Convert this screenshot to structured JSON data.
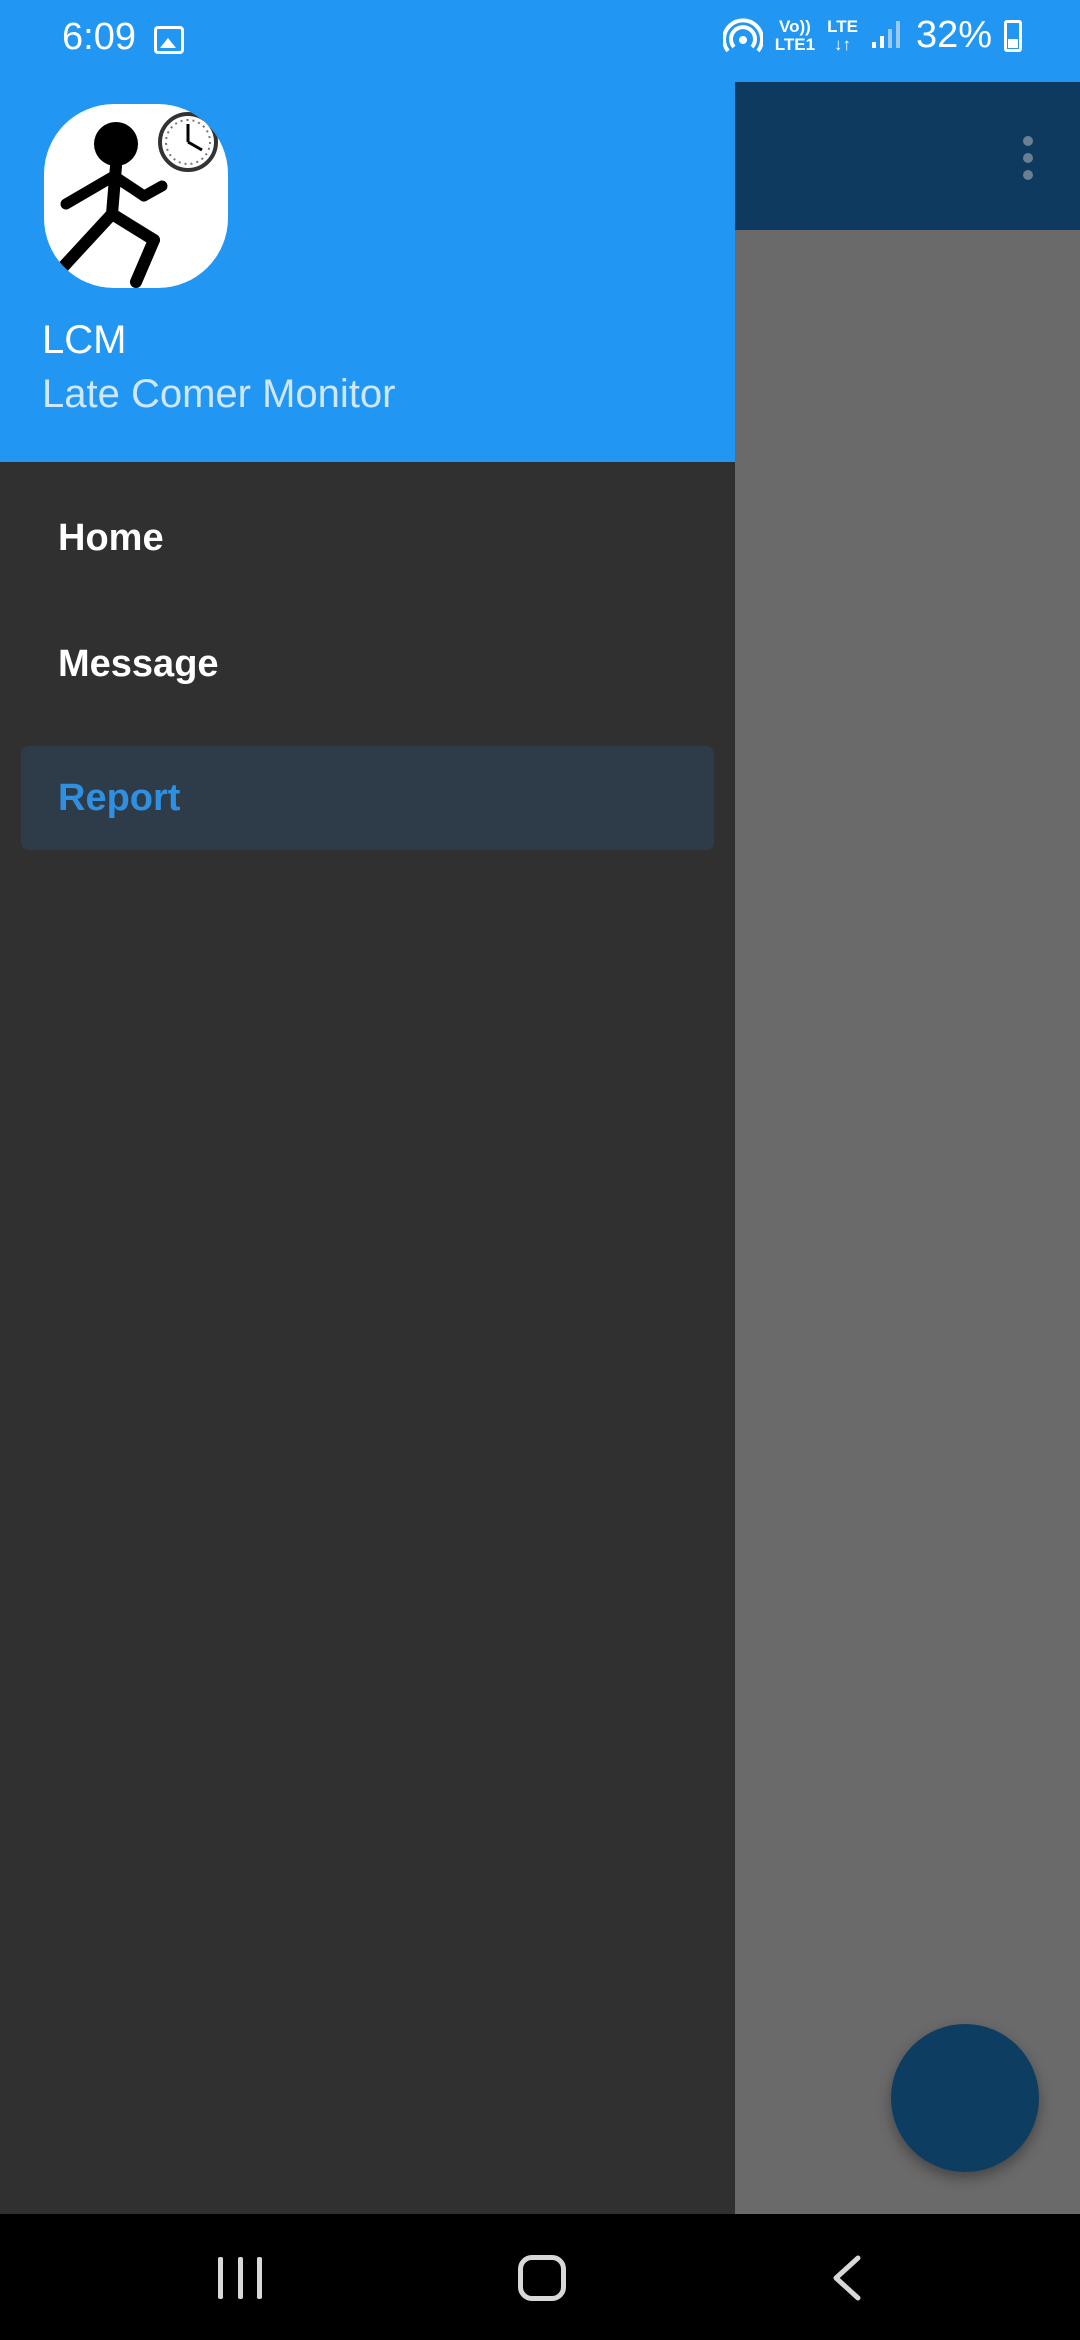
{
  "status_bar": {
    "time": "6:09",
    "network_top": "Vo))",
    "network_bottom": "LTE1",
    "lte_top": "LTE",
    "lte_bottom": "↓↑",
    "battery": "32%"
  },
  "drawer": {
    "header": {
      "app_name": "LCM",
      "app_subtitle": "Late Comer Monitor",
      "logo_icon": "running-stickman-clock-icon"
    },
    "items": [
      {
        "label": "Home",
        "active": false
      },
      {
        "label": "Message",
        "active": false
      },
      {
        "label": "Report",
        "active": true
      }
    ]
  },
  "colors": {
    "header": "#2196f3",
    "drawer_bg": "#303030",
    "active_item_bg": "#2e3c4a",
    "active_item_text": "#2f8fe0",
    "toolbar": "#0d3a5e",
    "fab": "#0e3d62"
  }
}
